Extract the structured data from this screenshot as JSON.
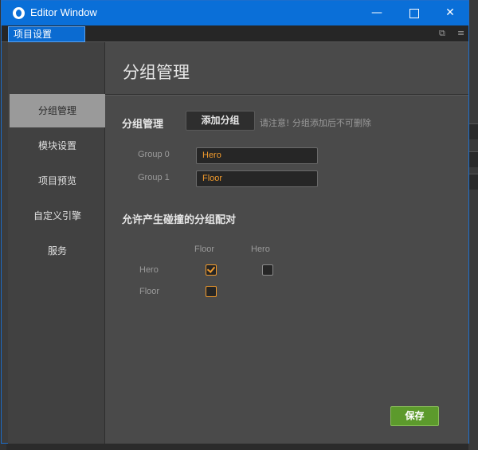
{
  "window": {
    "title": "Editor Window",
    "minimize_glyph": "—",
    "close_glyph": "✕"
  },
  "tab": {
    "label": "项目设置",
    "popout_glyph": "⧉",
    "menu_glyph": "≡"
  },
  "sidebar": {
    "items": [
      {
        "label": "分组管理",
        "active": true
      },
      {
        "label": "模块设置",
        "active": false
      },
      {
        "label": "项目预览",
        "active": false
      },
      {
        "label": "自定义引擎",
        "active": false
      },
      {
        "label": "服务",
        "active": false
      }
    ]
  },
  "main": {
    "page_title": "分组管理",
    "group_section": {
      "label": "分组管理",
      "add_button": "添加分组",
      "hint": "请注意! 分组添加后不可删除"
    },
    "groups": [
      {
        "label": "Group 0",
        "value": "Hero"
      },
      {
        "label": "Group 1",
        "value": "Floor"
      }
    ],
    "collision": {
      "label": "允许产生碰撞的分组配对",
      "columns": [
        "Floor",
        "Hero"
      ],
      "rows": [
        {
          "label": "Hero",
          "checks": [
            true,
            false
          ]
        },
        {
          "label": "Floor",
          "checks": [
            false
          ]
        }
      ]
    },
    "save_button": "保存"
  },
  "colors": {
    "accent_orange": "#f09a2c",
    "title_bar": "#0a6fd8",
    "save_green": "#5c9a2c"
  }
}
